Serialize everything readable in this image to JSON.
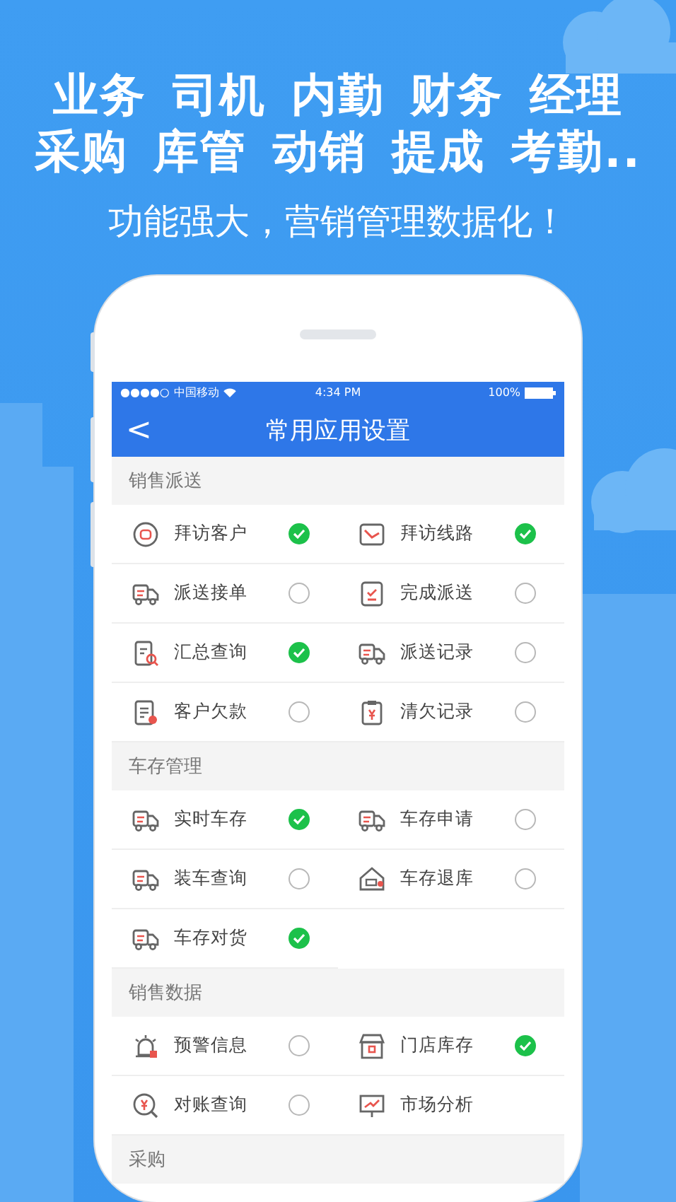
{
  "headline": {
    "lines": [
      "业务 司机 内勤 财务 经理",
      "采购 库管 动销 提成 考勤.."
    ],
    "tagline": "功能强大，营销管理数据化！"
  },
  "status_bar": {
    "signal": "●●●●○",
    "carrier": "中国移动",
    "time": "4:34 PM",
    "battery": "100%"
  },
  "nav": {
    "back": "<",
    "title": "常用应用设置"
  },
  "sections": [
    {
      "title": "销售派送",
      "items": [
        {
          "label": "拜访客户",
          "checked": true
        },
        {
          "label": "拜访线路",
          "checked": true
        },
        {
          "label": "派送接单",
          "checked": false
        },
        {
          "label": "完成派送",
          "checked": false
        },
        {
          "label": "汇总查询",
          "checked": true
        },
        {
          "label": "派送记录",
          "checked": false
        },
        {
          "label": "客户欠款",
          "checked": false
        },
        {
          "label": "清欠记录",
          "checked": false
        }
      ]
    },
    {
      "title": "车存管理",
      "items": [
        {
          "label": "实时车存",
          "checked": true
        },
        {
          "label": "车存申请",
          "checked": false
        },
        {
          "label": "装车查询",
          "checked": false
        },
        {
          "label": "车存退库",
          "checked": false
        },
        {
          "label": "车存对货",
          "checked": true
        }
      ]
    },
    {
      "title": "销售数据",
      "items": [
        {
          "label": "预警信息",
          "checked": false
        },
        {
          "label": "门店库存",
          "checked": true
        },
        {
          "label": "对账查询",
          "checked": false
        },
        {
          "label": "市场分析"
        }
      ]
    },
    {
      "title": "采购"
    }
  ]
}
